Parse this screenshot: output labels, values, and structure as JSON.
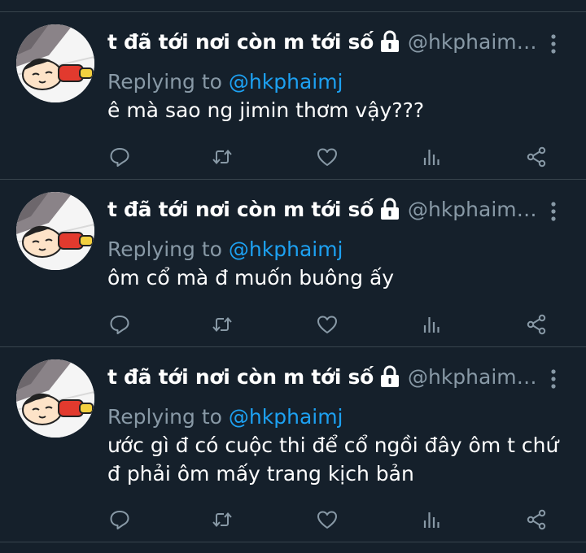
{
  "tweets": [
    {
      "display_name": "t đã tới nơi còn m tới số",
      "handle": "@hkphaim…",
      "replying_prefix": "Replying to",
      "replying_to": "@hkphaimj",
      "text": "ê mà sao ng jimin thơm vậy???"
    },
    {
      "display_name": "t đã tới nơi còn m tới số",
      "handle": "@hkphaim…",
      "replying_prefix": "Replying to",
      "replying_to": "@hkphaimj",
      "text": "ôm cổ mà đ muốn buông ấy"
    },
    {
      "display_name": "t đã tới nơi còn m tới số",
      "handle": "@hkphaim…",
      "replying_prefix": "Replying to",
      "replying_to": "@hkphaimj",
      "text": "ước gì đ có cuộc thi để cổ ngồi đây ôm t chứ đ phải ôm mấy trang kịch bản"
    }
  ],
  "icons": {
    "lock": "lock-icon",
    "more": "more-vertical-icon",
    "reply": "reply-icon",
    "retweet": "retweet-icon",
    "like": "heart-icon",
    "analytics": "analytics-icon",
    "share": "share-icon"
  },
  "colors": {
    "background": "#15202b",
    "divider": "#38444d",
    "secondary_text": "#8899a6",
    "mention": "#1da1f2",
    "primary_text": "#ffffff"
  }
}
